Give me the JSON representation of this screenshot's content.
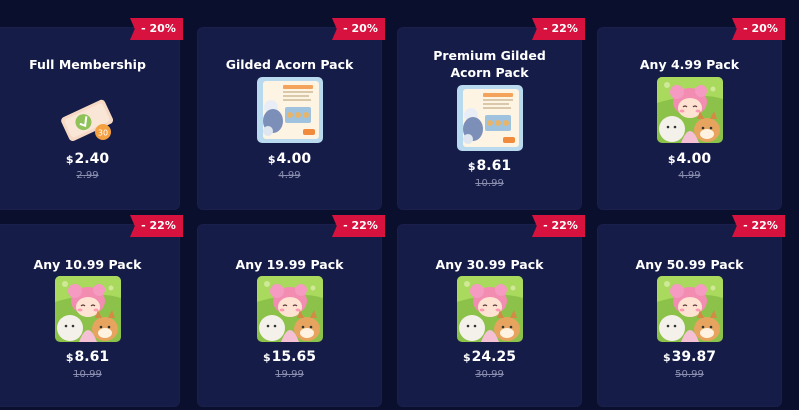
{
  "currency_symbol": "$",
  "colors": {
    "background": "#0b0f2e",
    "card": "#161c48",
    "discount_ribbon": "#d8123f"
  },
  "packs": [
    {
      "title": "Full Membership",
      "discount": "- 20%",
      "price": "2.40",
      "original": "2.99",
      "icon": "membership-ticket-icon"
    },
    {
      "title": "Gilded Acorn Pack",
      "discount": "- 20%",
      "price": "4.00",
      "original": "4.99",
      "icon": "gilded-acorn-pack-thumbnail"
    },
    {
      "title": "Premium Gilded Acorn Pack",
      "discount": "- 22%",
      "price": "8.61",
      "original": "10.99",
      "icon": "premium-gilded-acorn-pack-thumbnail"
    },
    {
      "title": "Any 4.99 Pack",
      "discount": "- 20%",
      "price": "4.00",
      "original": "4.99",
      "icon": "character-pack-thumbnail"
    },
    {
      "title": "Any 10.99 Pack",
      "discount": "- 22%",
      "price": "8.61",
      "original": "10.99",
      "icon": "character-pack-thumbnail"
    },
    {
      "title": "Any 19.99 Pack",
      "discount": "- 22%",
      "price": "15.65",
      "original": "19.99",
      "icon": "character-pack-thumbnail"
    },
    {
      "title": "Any 30.99 Pack",
      "discount": "- 22%",
      "price": "24.25",
      "original": "30.99",
      "icon": "character-pack-thumbnail"
    },
    {
      "title": "Any 50.99 Pack",
      "discount": "- 22%",
      "price": "39.87",
      "original": "50.99",
      "icon": "character-pack-thumbnail"
    }
  ]
}
